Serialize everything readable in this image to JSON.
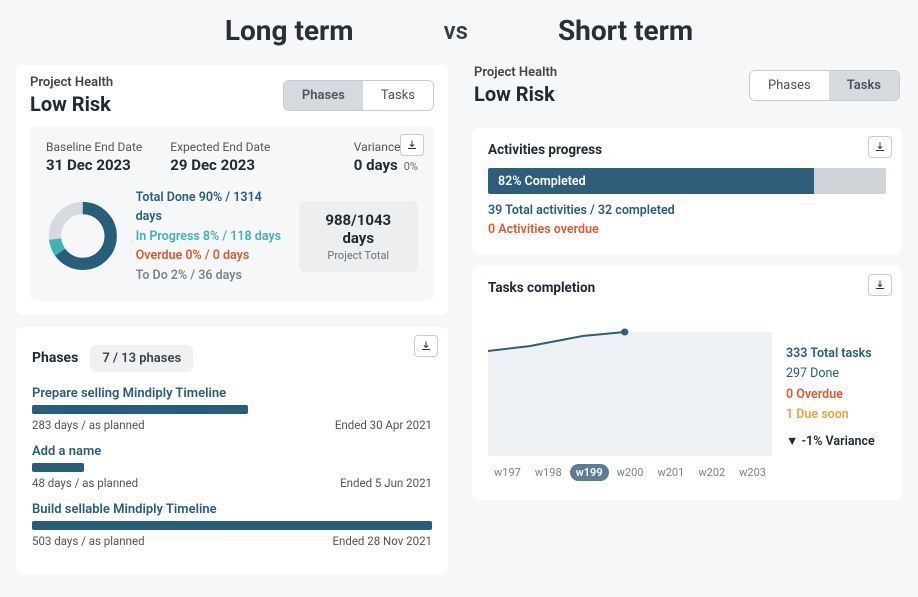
{
  "header": {
    "left": "Long term",
    "vs": "vs",
    "right": "Short term"
  },
  "left": {
    "ph_label": "Project Health",
    "ph_status": "Low Risk",
    "toggle": {
      "phases": "Phases",
      "tasks": "Tasks",
      "active": "phases"
    },
    "dates": {
      "baseline_label": "Baseline End Date",
      "baseline_value": "31 Dec 2023",
      "expected_label": "Expected End Date",
      "expected_value": "29 Dec 2023",
      "variance_label": "Variance",
      "variance_value": "0 days",
      "variance_pct": "0%"
    },
    "donut": {
      "done_pct": 90,
      "progress_pct": 8,
      "todo_pct": 2,
      "legend": {
        "done": "Total Done 90% / 1314 days",
        "progress": "In Progress 8% / 118 days",
        "overdue": "Overdue 0% / 0 days",
        "todo": "To Do 2% / 36 days"
      }
    },
    "totals": {
      "main": "988/1043 days",
      "sub": "Project Total"
    },
    "phases": {
      "title": "Phases",
      "count": "7 / 13 phases",
      "items": [
        {
          "name": "Prepare selling Mindiply Timeline",
          "bar_pct": 54,
          "foot": "283 days / as planned",
          "ended": "Ended 30 Apr 2021"
        },
        {
          "name": "Add a name",
          "bar_pct": 13,
          "foot": "48 days / as planned",
          "ended": "Ended 5 Jun 2021"
        },
        {
          "name": "Build sellable Mindiply Timeline",
          "bar_pct": 100,
          "foot": "503 days / as planned",
          "ended": "Ended 28 Nov 2021"
        }
      ]
    }
  },
  "right": {
    "ph_label": "Project Health",
    "ph_status": "Low Risk",
    "toggle": {
      "phases": "Phases",
      "tasks": "Tasks",
      "active": "tasks"
    },
    "activities": {
      "title": "Activities progress",
      "pct": 82,
      "pct_label": "82% Completed",
      "sub1": "39 Total activities / 32 completed",
      "sub2": "0 Activities overdue"
    },
    "tasks": {
      "title": "Tasks completion",
      "weeks": [
        "w197",
        "w198",
        "w199",
        "w200",
        "w201",
        "w202",
        "w203"
      ],
      "active_week": "w199",
      "stats": {
        "total": "333 Total tasks",
        "done": "297 Done",
        "overdue": "0 Overdue",
        "due_soon": "1 Due soon",
        "variance": "▼ -1% Variance"
      }
    }
  },
  "chart_data": [
    {
      "type": "pie",
      "title": "Project progress donut",
      "series": [
        {
          "name": "Total Done",
          "value": 90
        },
        {
          "name": "In Progress",
          "value": 8
        },
        {
          "name": "Overdue",
          "value": 0
        },
        {
          "name": "To Do",
          "value": 2
        }
      ]
    },
    {
      "type": "line",
      "title": "Tasks completion trend",
      "x": [
        "w197",
        "w198",
        "w199",
        "w200",
        "w201",
        "w202",
        "w203"
      ],
      "series": [
        {
          "name": "Completion",
          "values": [
            78,
            80,
            82,
            null,
            null,
            null,
            null
          ]
        }
      ],
      "ylim": [
        0,
        100
      ]
    }
  ]
}
